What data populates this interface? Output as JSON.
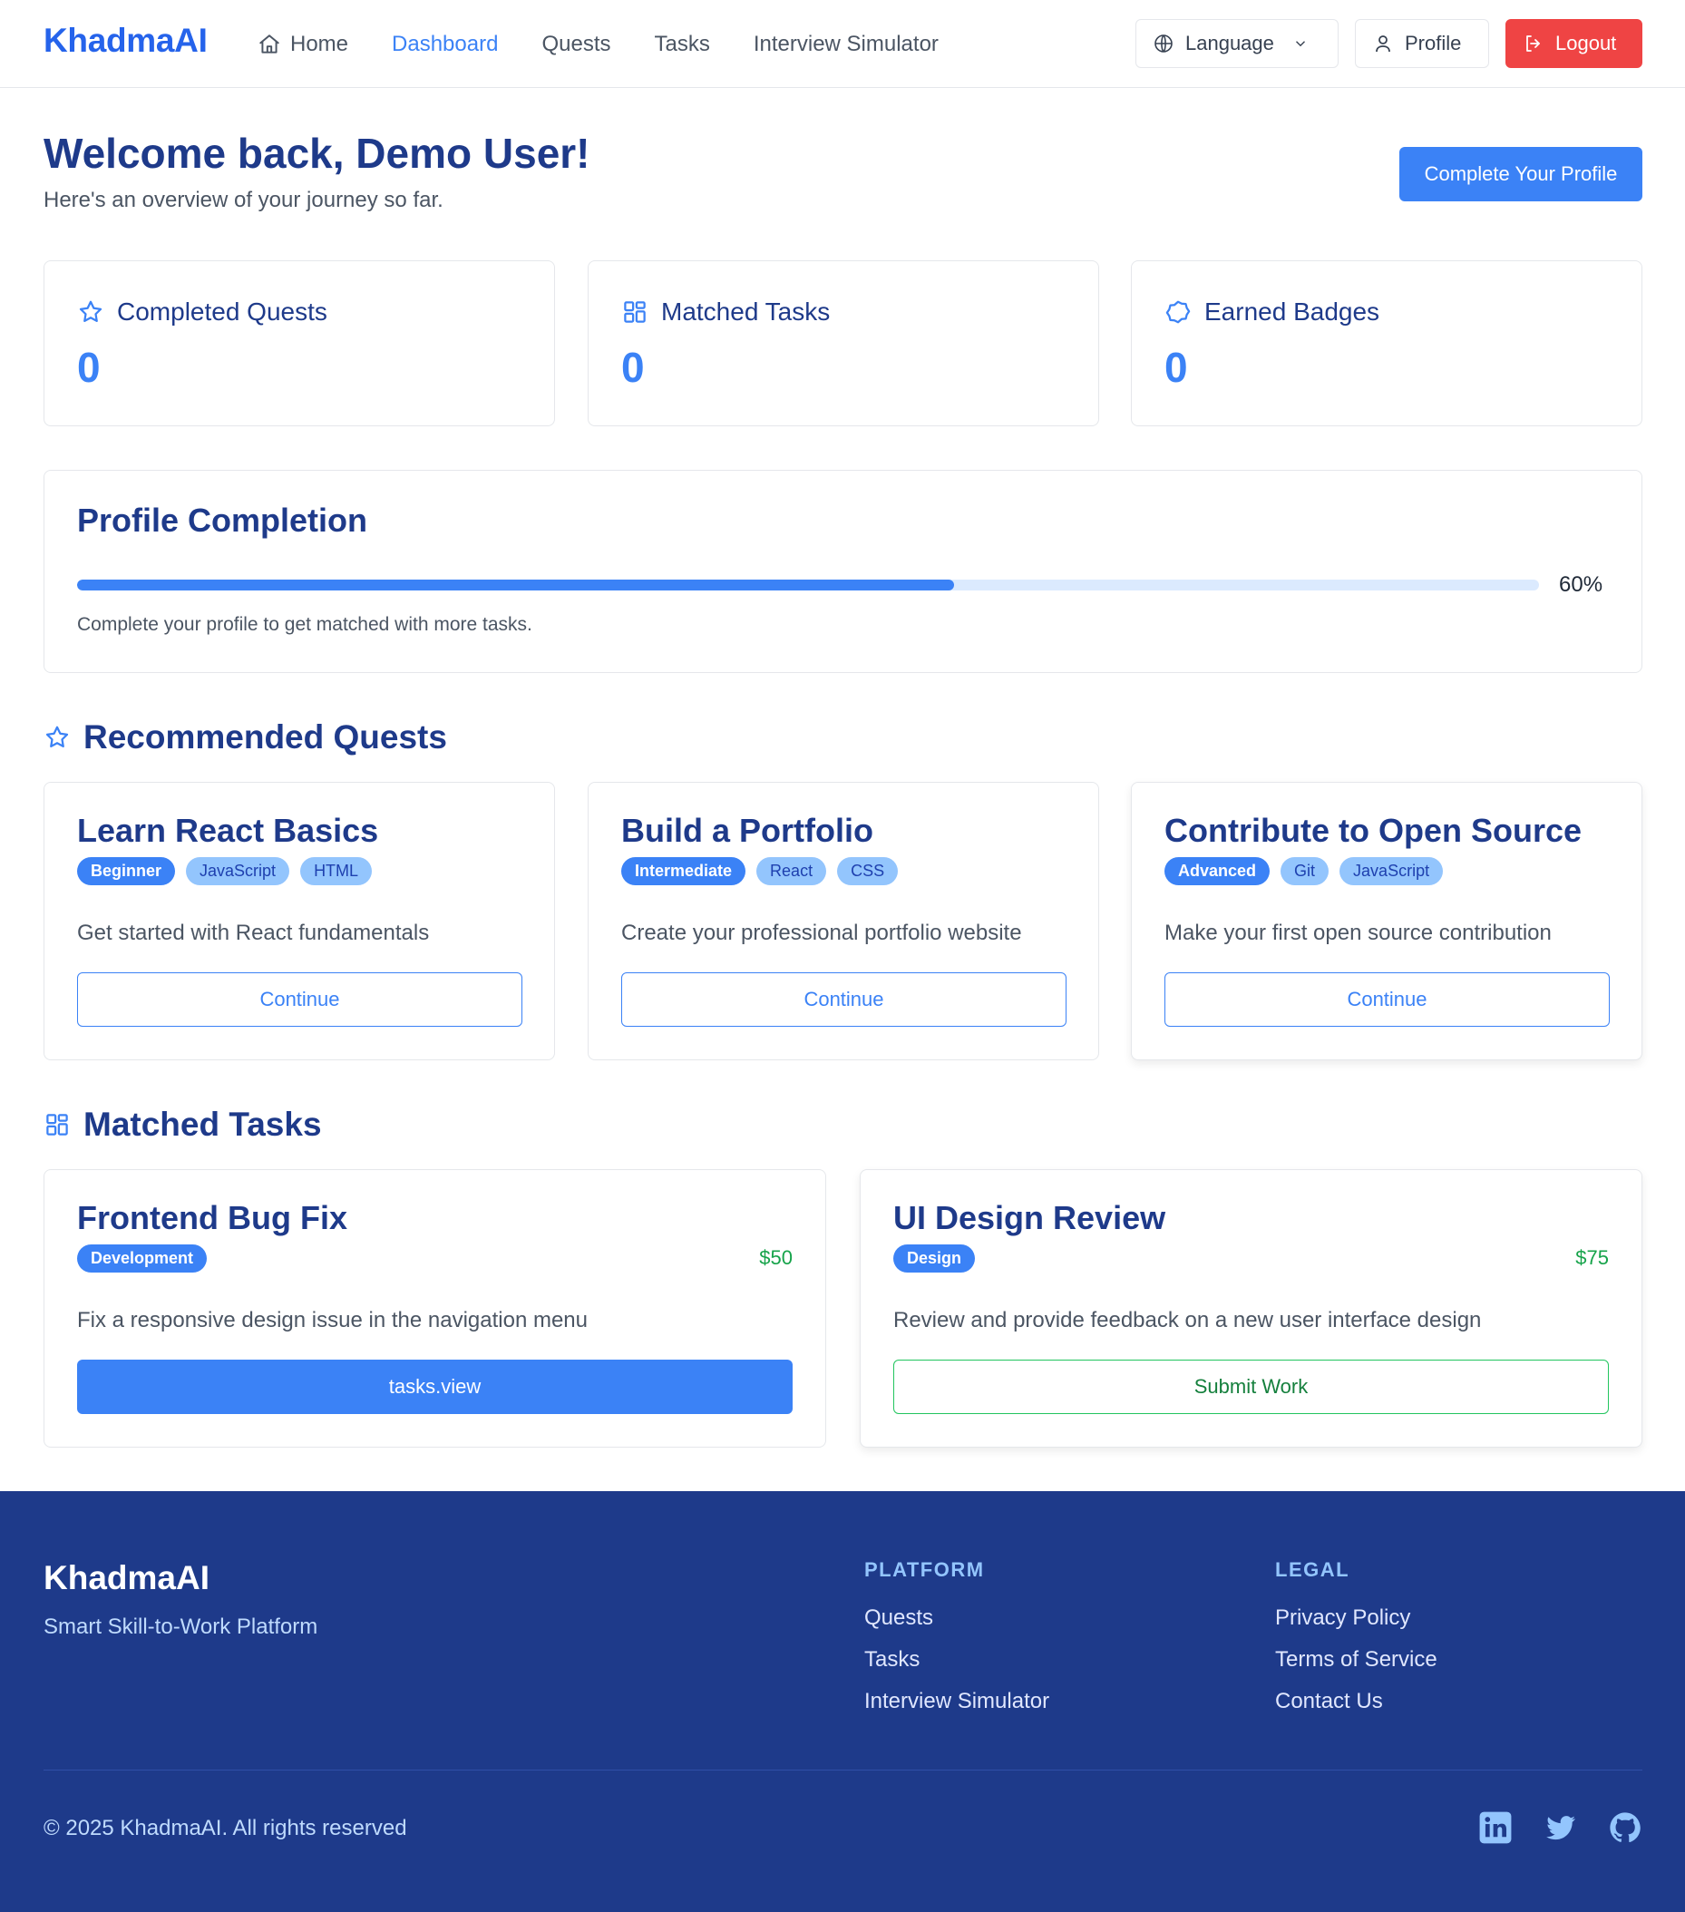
{
  "header": {
    "logo": "KhadmaAI",
    "nav": [
      {
        "label": "Home",
        "icon": "home-icon"
      },
      {
        "label": "Dashboard"
      },
      {
        "label": "Quests"
      },
      {
        "label": "Tasks"
      },
      {
        "label": "Interview Simulator"
      }
    ],
    "language_label": "Language",
    "profile_label": "Profile",
    "logout_label": "Logout"
  },
  "welcome": {
    "title": "Welcome back, Demo User!",
    "subtitle": "Here's an overview of your journey so far.",
    "cta_label": "Complete Your Profile"
  },
  "stats": [
    {
      "label": "Completed Quests",
      "value": "0",
      "icon": "star-icon"
    },
    {
      "label": "Matched Tasks",
      "value": "0",
      "icon": "grid-icon"
    },
    {
      "label": "Earned Badges",
      "value": "0",
      "icon": "badge-icon"
    }
  ],
  "profile_completion": {
    "title": "Profile Completion",
    "percent": 60,
    "percent_label": "60%",
    "note": "Complete your profile to get matched with more tasks."
  },
  "quests_section": {
    "title": "Recommended Quests",
    "items": [
      {
        "title": "Learn React Basics",
        "level": "Beginner",
        "tags": [
          "JavaScript",
          "HTML"
        ],
        "description": "Get started with React fundamentals",
        "button": "Continue"
      },
      {
        "title": "Build a Portfolio",
        "level": "Intermediate",
        "tags": [
          "React",
          "CSS"
        ],
        "description": "Create your professional portfolio website",
        "button": "Continue"
      },
      {
        "title": "Contribute to Open Source",
        "level": "Advanced",
        "tags": [
          "Git",
          "JavaScript"
        ],
        "description": "Make your first open source contribution",
        "button": "Continue"
      }
    ]
  },
  "tasks_section": {
    "title": "Matched Tasks",
    "items": [
      {
        "title": "Frontend Bug Fix",
        "category": "Development",
        "price": "$50",
        "description": "Fix a responsive design issue in the navigation menu",
        "button": "tasks.view"
      },
      {
        "title": "UI Design Review",
        "category": "Design",
        "price": "$75",
        "description": "Review and provide feedback on a new user interface design",
        "button": "Submit Work"
      }
    ]
  },
  "footer": {
    "logo": "KhadmaAI",
    "tagline": "Smart Skill-to-Work Platform",
    "platform_title": "PLATFORM",
    "platform_links": [
      "Quests",
      "Tasks",
      "Interview Simulator"
    ],
    "legal_title": "LEGAL",
    "legal_links": [
      "Privacy Policy",
      "Terms of Service",
      "Contact Us"
    ],
    "copyright": "© 2025 KhadmaAI. All rights reserved",
    "social": [
      "linkedin-icon",
      "twitter-icon",
      "github-icon"
    ]
  },
  "colors": {
    "accent": "#3b82f6",
    "heading": "#1e3a8a",
    "danger": "#ef4444",
    "success": "#16a34a",
    "footer_bg": "#1e3a8a"
  }
}
